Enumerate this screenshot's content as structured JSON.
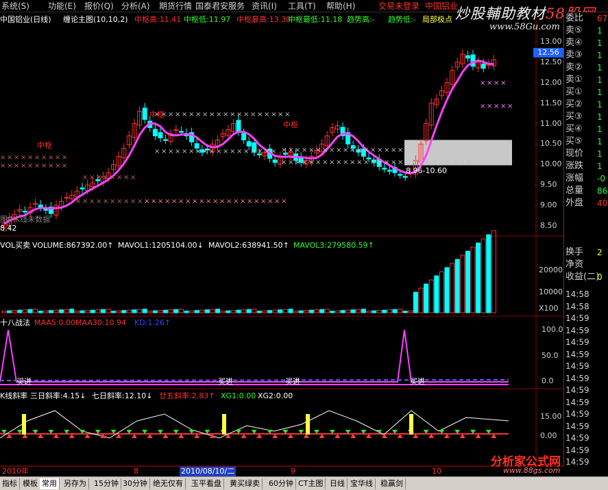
{
  "menu": {
    "items": [
      "系统(S)",
      "功能(E)",
      "报价(Q)",
      "分析(A)",
      "期货行情",
      "国泰君安服务",
      "资讯(I)",
      "工具(T)",
      "帮助(H)"
    ],
    "status": "交易未登录",
    "stock_short": "中国铝业"
  },
  "watermark": {
    "brand": "炒股輔助教材",
    "site": "58股网",
    "url": "www.58Gu.com"
  },
  "main_chart": {
    "title": "中国铝业(日线)",
    "indicator": "缠论主图(10,10,2)",
    "labels": [
      {
        "text": "中枢高:11.41",
        "color": "#ff3030"
      },
      {
        "text": "中枢低:11.97",
        "color": "#30ff30"
      },
      {
        "text": "中枢最高:13.30",
        "color": "#ff3030"
      },
      {
        "text": "中枢最低:11.18",
        "color": "#30ff30"
      },
      {
        "text": "趋势高:-",
        "color": "#30ff30"
      },
      {
        "text": "趋势低:-",
        "color": "#30ff30"
      },
      {
        "text": "局部极点",
        "color": "#ffff40"
      }
    ],
    "zone_labels": [
      "中枢",
      "中枢",
      "中枢"
    ],
    "range_label": "8.96-10.60",
    "low_label": "8.42",
    "footnote": "图中K线未数据",
    "y_ticks": [
      "13.00",
      "12.50",
      "12.00",
      "11.50",
      "11.00",
      "10.50",
      "10.00",
      "9.50",
      "9.00",
      "8.50"
    ],
    "current_price": "12.56"
  },
  "volume_panel": {
    "labels": [
      {
        "text": "VOL买卖",
        "color": "#ffffff"
      },
      {
        "text": "VOLUME:867392.00↑",
        "color": "#ffffff"
      },
      {
        "text": "MAVOL1:1205104.00↓",
        "color": "#ffffff"
      },
      {
        "text": "MAVOL2:638941.50↑",
        "color": "#ffffff"
      },
      {
        "text": "MAVOL3:279580.59↑",
        "color": "#30ff30"
      }
    ],
    "y_ticks": [
      "20000",
      "10000",
      "X100"
    ]
  },
  "strategy_panel": {
    "labels": [
      {
        "text": "十八战法",
        "color": "#ffffff"
      },
      {
        "text": "MAA5:0.00",
        "color": "#ff3030"
      },
      {
        "text": "MAA30:10.94",
        "color": "#ff3030"
      },
      {
        "text": "KD:1.26↑",
        "color": "#4040ff"
      }
    ],
    "buy_labels": [
      "买进",
      "买进",
      "买进",
      "买进"
    ],
    "y_ticks": [
      "100.0",
      "50.0",
      "0.0"
    ]
  },
  "slope_panel": {
    "labels": [
      {
        "text": "K线斜率",
        "color": "#ffffff"
      },
      {
        "text": "三日斜率:4.15↓",
        "color": "#ffffff"
      },
      {
        "text": "七日斜率:12.10↓",
        "color": "#ffffff"
      },
      {
        "text": "廿五斜率:2.83↑",
        "color": "#ff3030"
      },
      {
        "text": "XG1:0.00",
        "color": "#30ff30"
      },
      {
        "text": "XG2:0.00",
        "color": "#ffffff"
      }
    ],
    "y_ticks": [
      "15.00",
      "0.00"
    ]
  },
  "quote_panel": {
    "top_label": "委比",
    "top_value": "67",
    "rows": [
      {
        "label": "卖⑤",
        "value": "1"
      },
      {
        "label": "卖④",
        "value": "1"
      },
      {
        "label": "卖③",
        "value": "1"
      },
      {
        "label": "卖②",
        "value": "1"
      },
      {
        "label": "卖①",
        "value": "1"
      },
      {
        "label": "买①",
        "value": "1"
      },
      {
        "label": "买②",
        "value": "1"
      },
      {
        "label": "买③",
        "value": "1"
      },
      {
        "label": "买④",
        "value": "1"
      },
      {
        "label": "买⑤",
        "value": "1"
      },
      {
        "label": "现价",
        "value": "1"
      },
      {
        "label": "涨跌",
        "value": "1"
      },
      {
        "label": "涨幅",
        "value": "-0"
      },
      {
        "label": "总量",
        "value": "86"
      },
      {
        "label": "外盘",
        "value": "40"
      }
    ],
    "rows2": [
      {
        "label": "换手",
        "value": "2"
      },
      {
        "label": "净资",
        "value": ""
      },
      {
        "label": "收益(二)",
        "value": "0"
      }
    ],
    "times": [
      "14:58",
      "14:58",
      "14:59",
      "14:59",
      "14:59",
      "14:59",
      "14:59",
      "14:59",
      "14:59",
      "14:59",
      "14:59",
      "14:59",
      "14:59",
      "14:59",
      "14:59",
      "14:59"
    ]
  },
  "date_axis": {
    "labels": [
      "2010年",
      "8",
      "2010/08/10/二",
      "9",
      "10"
    ]
  },
  "tabs": [
    "指标",
    "模板",
    "常用",
    "另存为",
    "15分钟",
    "30分钟",
    "绝无仅有",
    "玉平看盘",
    "黄买绿卖",
    "60分钟",
    "CT主图",
    "日线",
    "宝华线",
    "稳赢剑"
  ],
  "logo": {
    "text": "分析家公式网",
    "url": "www.88gs.com"
  },
  "colors": {
    "up": "#ff3030",
    "down": "#00ffff",
    "ma": "#ff40ff",
    "bg": "#000000"
  }
}
